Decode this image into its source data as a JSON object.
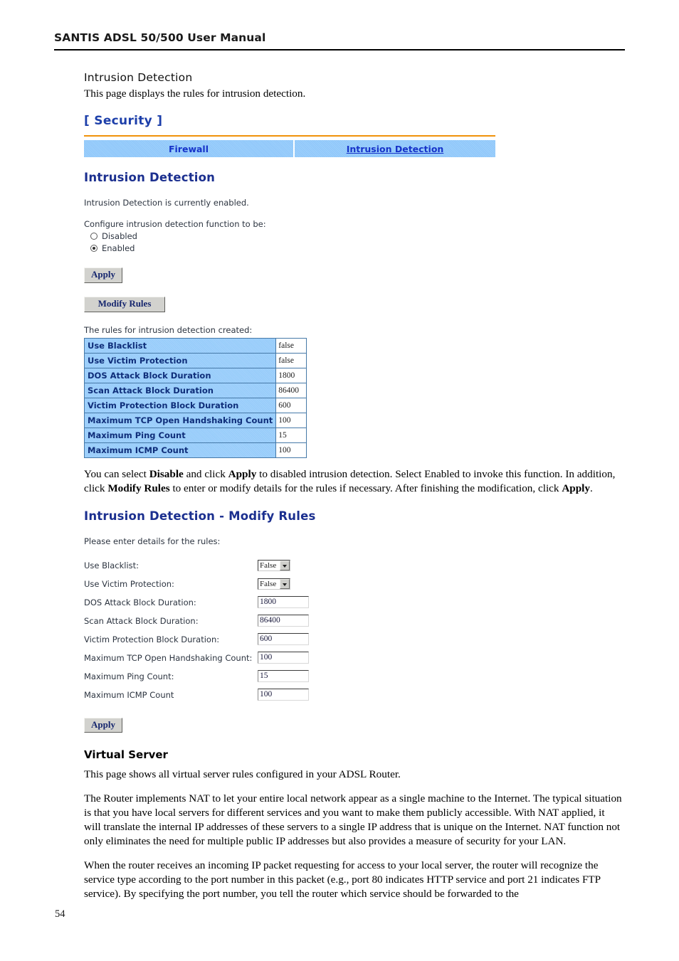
{
  "header": {
    "title": "SANTIS ADSL 50/500 User Manual"
  },
  "intro": {
    "heading": "Intrusion Detection",
    "description": "This page displays the rules for intrusion detection."
  },
  "webui": {
    "panel_title": "[ Security ]",
    "tabs": [
      {
        "label": "Firewall",
        "active": "false"
      },
      {
        "label": "Intrusion Detection",
        "active": "true"
      }
    ],
    "section_heading": "Intrusion Detection",
    "status_text": "Intrusion Detection is currently enabled.",
    "configure_label": "Configure intrusion detection function to be:",
    "radio_disabled_label": "Disabled",
    "radio_enabled_label": "Enabled",
    "apply_label": "Apply",
    "modify_rules_label": "Modify Rules",
    "rules_caption": "The rules for intrusion detection created:",
    "rules_table": {
      "rows": [
        {
          "label": "Use Blacklist",
          "value": "false"
        },
        {
          "label": "Use Victim Protection",
          "value": "false"
        },
        {
          "label": "DOS Attack Block Duration",
          "value": "1800"
        },
        {
          "label": "Scan Attack Block Duration",
          "value": "86400"
        },
        {
          "label": "Victim Protection Block Duration",
          "value": "600"
        },
        {
          "label": "Maximum TCP Open Handshaking Count",
          "value": "100"
        },
        {
          "label": "Maximum Ping Count",
          "value": "15"
        },
        {
          "label": "Maximum ICMP Count",
          "value": "100"
        }
      ]
    }
  },
  "body_paragraph_1": {
    "part1": "You can select ",
    "bold1": "Disable",
    "part2": " and click ",
    "bold2": "Apply",
    "part3": " to disabled intrusion detection. Select Enabled to invoke this function. In addition, click ",
    "bold3": "Modify Rules",
    "part4": " to enter or modify details for the rules if necessary. After finishing the modification, click ",
    "bold4": "Apply",
    "part5": "."
  },
  "modify_rules": {
    "heading": "Intrusion Detection - Modify Rules",
    "caption": "Please enter details for the rules:",
    "fields": [
      {
        "label": "Use Blacklist:",
        "type": "select",
        "value": "False"
      },
      {
        "label": "Use Victim Protection:",
        "type": "select",
        "value": "False"
      },
      {
        "label": "DOS Attack Block Duration:",
        "type": "input",
        "value": "1800"
      },
      {
        "label": "Scan Attack Block Duration:",
        "type": "input",
        "value": "86400"
      },
      {
        "label": "Victim Protection Block Duration:",
        "type": "input",
        "value": "600"
      },
      {
        "label": "Maximum TCP Open Handshaking Count:",
        "type": "input",
        "value": "100"
      },
      {
        "label": "Maximum Ping Count:",
        "type": "input",
        "value": "15"
      },
      {
        "label": "Maximum ICMP Count",
        "type": "input",
        "value": "100"
      }
    ],
    "apply_label": "Apply"
  },
  "virtual_server": {
    "heading": "Virtual Server",
    "paragraph_1": "This page shows all virtual server rules configured in your ADSL Router.",
    "paragraph_2": "The Router implements NAT to let your entire local network appear as a single machine to the Internet. The typical situation is that you have local servers for different services and you want to make them publicly accessible. With NAT applied, it will translate the internal IP addresses of these servers to a single IP address that is unique on the Internet. NAT function not only eliminates the need for multiple public IP addresses but also provides a measure of security for your LAN.",
    "paragraph_3": "When the router receives an incoming IP packet requesting for access to your local server, the router will recognize the service type according to the port number in this packet (e.g., port 80 indicates HTTP service and port 21 indicates FTP service). By specifying the port number, you tell the router which service should be forwarded to the"
  },
  "footer": {
    "page_number": "54"
  },
  "colors": {
    "tab_blue": "#96cbfa",
    "link_blue": "#1633c9",
    "orange_rule": "#f0920a",
    "heading_navy": "#1b2f8f",
    "table_border": "#4679a8"
  }
}
